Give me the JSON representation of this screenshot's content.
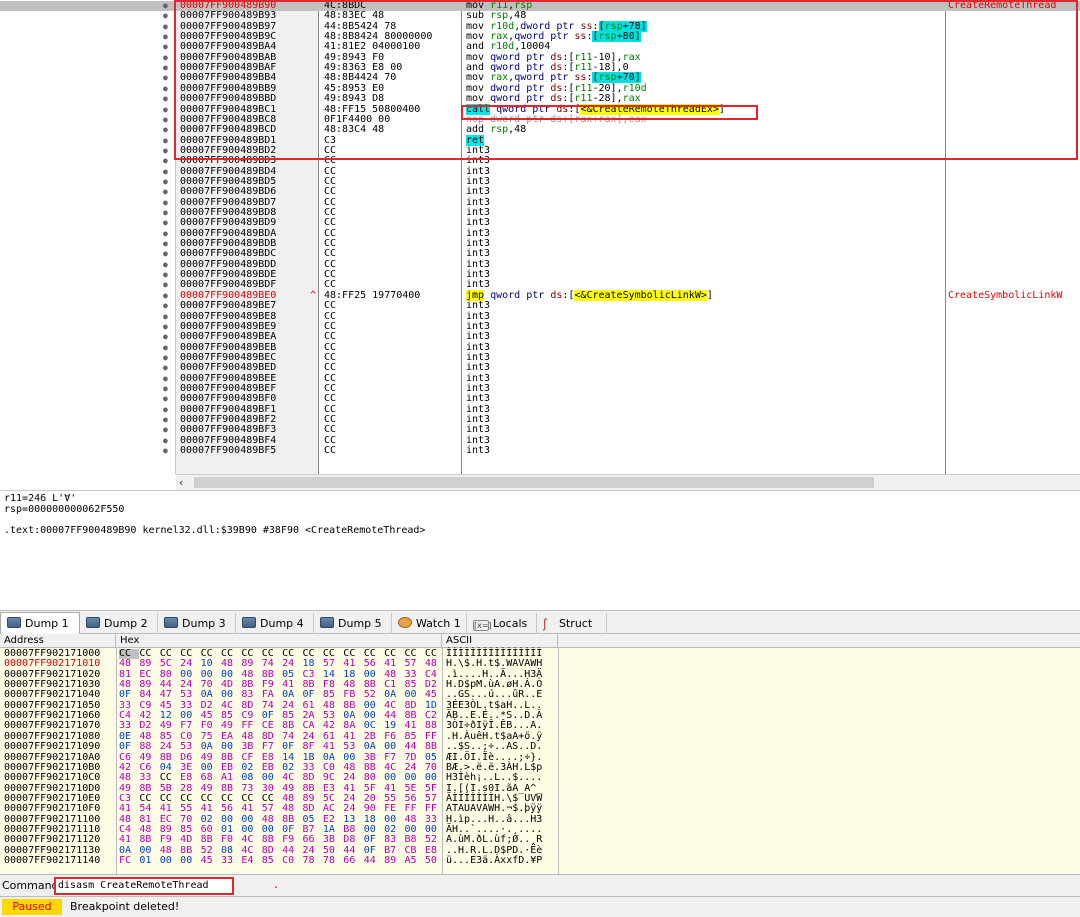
{
  "disasm": {
    "rows": [
      {
        "addr": "00007FF900489B90",
        "bytes": "4C:8BDC",
        "instr": "mov r11,rsp",
        "comment": "CreateRemoteThread",
        "current": true,
        "red": true
      },
      {
        "addr": "00007FF900489B93",
        "bytes": "48:83EC 48",
        "instr": "sub rsp,48"
      },
      {
        "addr": "00007FF900489B97",
        "bytes": "44:8B5424 78",
        "instr": "mov r10d,dword ptr ss:[rsp+78]"
      },
      {
        "addr": "00007FF900489B9C",
        "bytes": "48:8B8424 80000000",
        "instr": "mov rax,qword ptr ss:[rsp+80]"
      },
      {
        "addr": "00007FF900489BA4",
        "bytes": "41:81E2 04000100",
        "instr": "and r10d,10004"
      },
      {
        "addr": "00007FF900489BAB",
        "bytes": "49:8943 F0",
        "instr": "mov qword ptr ds:[r11-10],rax"
      },
      {
        "addr": "00007FF900489BAF",
        "bytes": "49:8363 E8 00",
        "instr": "and qword ptr ds:[r11-18],0"
      },
      {
        "addr": "00007FF900489BB4",
        "bytes": "48:8B4424 70",
        "instr": "mov rax,qword ptr ss:[rsp+70]"
      },
      {
        "addr": "00007FF900489BB9",
        "bytes": "45:8953 E0",
        "instr": "mov dword ptr ds:[r11-20],r10d"
      },
      {
        "addr": "00007FF900489BBD",
        "bytes": "49:8943 D8",
        "instr": "mov qword ptr ds:[r11-28],rax"
      },
      {
        "addr": "00007FF900489BC1",
        "bytes": "48:FF15 50800400",
        "instr": "call qword ptr ds:[<&CreateRemoteThreadEx>]"
      },
      {
        "addr": "00007FF900489BC8",
        "bytes": "0F1F4400 00",
        "instr": "nop dword ptr ds:[rax+rax],eax"
      },
      {
        "addr": "00007FF900489BCD",
        "bytes": "48:83C4 48",
        "instr": "add rsp,48"
      },
      {
        "addr": "00007FF900489BD1",
        "bytes": "C3",
        "instr": "ret"
      },
      {
        "addr": "00007FF900489BD2",
        "bytes": "CC",
        "instr": "int3"
      },
      {
        "addr": "00007FF900489BD3",
        "bytes": "CC",
        "instr": "int3"
      },
      {
        "addr": "00007FF900489BD4",
        "bytes": "CC",
        "instr": "int3"
      },
      {
        "addr": "00007FF900489BD5",
        "bytes": "CC",
        "instr": "int3"
      },
      {
        "addr": "00007FF900489BD6",
        "bytes": "CC",
        "instr": "int3"
      },
      {
        "addr": "00007FF900489BD7",
        "bytes": "CC",
        "instr": "int3"
      },
      {
        "addr": "00007FF900489BD8",
        "bytes": "CC",
        "instr": "int3"
      },
      {
        "addr": "00007FF900489BD9",
        "bytes": "CC",
        "instr": "int3"
      },
      {
        "addr": "00007FF900489BDA",
        "bytes": "CC",
        "instr": "int3"
      },
      {
        "addr": "00007FF900489BDB",
        "bytes": "CC",
        "instr": "int3"
      },
      {
        "addr": "00007FF900489BDC",
        "bytes": "CC",
        "instr": "int3"
      },
      {
        "addr": "00007FF900489BDD",
        "bytes": "CC",
        "instr": "int3"
      },
      {
        "addr": "00007FF900489BDE",
        "bytes": "CC",
        "instr": "int3"
      },
      {
        "addr": "00007FF900489BDF",
        "bytes": "CC",
        "instr": "int3"
      },
      {
        "addr": "00007FF900489BE0",
        "bytes": "48:FF25 19770400",
        "instr": "jmp qword ptr ds:[<&CreateSymbolicLinkW>]",
        "comment": "CreateSymbolicLinkW",
        "red": true,
        "jumpMark": "^"
      },
      {
        "addr": "00007FF900489BE7",
        "bytes": "CC",
        "instr": "int3"
      },
      {
        "addr": "00007FF900489BE8",
        "bytes": "CC",
        "instr": "int3"
      },
      {
        "addr": "00007FF900489BE9",
        "bytes": "CC",
        "instr": "int3"
      },
      {
        "addr": "00007FF900489BEA",
        "bytes": "CC",
        "instr": "int3"
      },
      {
        "addr": "00007FF900489BEB",
        "bytes": "CC",
        "instr": "int3"
      },
      {
        "addr": "00007FF900489BEC",
        "bytes": "CC",
        "instr": "int3"
      },
      {
        "addr": "00007FF900489BED",
        "bytes": "CC",
        "instr": "int3"
      },
      {
        "addr": "00007FF900489BEE",
        "bytes": "CC",
        "instr": "int3"
      },
      {
        "addr": "00007FF900489BEF",
        "bytes": "CC",
        "instr": "int3"
      },
      {
        "addr": "00007FF900489BF0",
        "bytes": "CC",
        "instr": "int3"
      },
      {
        "addr": "00007FF900489BF1",
        "bytes": "CC",
        "instr": "int3"
      },
      {
        "addr": "00007FF900489BF2",
        "bytes": "CC",
        "instr": "int3"
      },
      {
        "addr": "00007FF900489BF3",
        "bytes": "CC",
        "instr": "int3"
      },
      {
        "addr": "00007FF900489BF4",
        "bytes": "CC",
        "instr": "int3"
      },
      {
        "addr": "00007FF900489BF5",
        "bytes": "CC",
        "instr": "int3"
      }
    ]
  },
  "info": {
    "line1": "r11=246 L'Ɐ'",
    "line2": "rsp=000000000062F550",
    "line3": ".text:00007FF900489B90 kernel32.dll:$39B90 #38F90 <CreateRemoteThread>"
  },
  "tabs": [
    {
      "label": "Dump 1",
      "icon": "dump-icon",
      "active": true
    },
    {
      "label": "Dump 2",
      "icon": "dump-icon"
    },
    {
      "label": "Dump 3",
      "icon": "dump-icon"
    },
    {
      "label": "Dump 4",
      "icon": "dump-icon"
    },
    {
      "label": "Dump 5",
      "icon": "dump-icon"
    },
    {
      "label": "Watch 1",
      "icon": "watch-icon"
    },
    {
      "label": "Locals",
      "icon": "locals-icon",
      "iconText": "[x=]"
    },
    {
      "label": "Struct",
      "icon": "struct-icon",
      "iconText": "ʃ"
    }
  ],
  "dump": {
    "headers": {
      "address": "Address",
      "hex": "Hex",
      "ascii": "ASCII"
    },
    "rows": [
      {
        "addr": "00007FF902171000",
        "hex": "CC CC CC CC CC CC CC CC CC CC CC CC CC CC CC CC",
        "ascii": "ÌÌÌÌÌÌÌÌÌÌÌÌÌÌÌÌ",
        "selFirst": true
      },
      {
        "addr": "00007FF902171010",
        "hex": "48 89 5C 24 10 48 89 74 24 18 57 41 56 41 57 48",
        "ascii": "H.\\$.H.t$.WAVAWH",
        "red": true
      },
      {
        "addr": "00007FF902171020",
        "hex": "81 EC 80 00 00 00 48 8B 05 C3 14 18 00 48 33 C4",
        "ascii": ".ì....H..Ã...H3Ä"
      },
      {
        "addr": "00007FF902171030",
        "hex": "48 89 44 24 70 4D 8B F9 41 8B F8 48 8B C1 85 D2",
        "ascii": "H.D$pM.ùA.øH.Á.Ò"
      },
      {
        "addr": "00007FF902171040",
        "hex": "0F 84 47 53 0A 00 83 FA 0A 0F 85 FB 52 0A 00 45",
        "ascii": "..GS...ú...ûR..E"
      },
      {
        "addr": "00007FF902171050",
        "hex": "33 C9 45 33 D2 4C 8D 74 24 61 48 8B 00 4C 8D 1D",
        "ascii": "3ÉE3ÒL.t$aH..L.."
      },
      {
        "addr": "00007FF902171060",
        "hex": "C4 42 12 00 45 85 C9 0F 85 2A 53 0A 00 44 8B C2",
        "ascii": "ÄB..E.É..*S..D.Â"
      },
      {
        "addr": "00007FF902171070",
        "hex": "33 D2 49 F7 F0 49 FF CE 8B CA 42 8A 0C 19 41 88",
        "ascii": "3ÒI÷ðIÿÎ.ÊB...A."
      },
      {
        "addr": "00007FF902171080",
        "hex": "0E 48 85 C0 75 EA 48 8D 74 24 61 41 2B F6 85 FF",
        "ascii": ".H.ÀuêH.t$aA+ö.ÿ"
      },
      {
        "addr": "00007FF902171090",
        "hex": "0F 88 24 53 0A 00 3B F7 0F 8F 41 53 0A 00 44 8B",
        "ascii": "..$S..;÷..AS..D."
      },
      {
        "addr": "00007FF9021710A0",
        "hex": "C6 49 8B D6 49 8B CF E8 14 1B 0A 00 3B F7 7D 05",
        "ascii": "ÆI.ÖI.Ïè....;÷}."
      },
      {
        "addr": "00007FF9021710B0",
        "hex": "42 C6 04 3E 00 EB 02 EB 02 33 C0 48 8B 4C 24 70",
        "ascii": "BÆ.>.ë.ë.3ÀH.L$p"
      },
      {
        "addr": "00007FF9021710C0",
        "hex": "48 33 CC E8 68 A1 08 00 4C 8D 9C 24 80 00 00 00",
        "ascii": "H3Ìèh¡..L..$...."
      },
      {
        "addr": "00007FF9021710D0",
        "hex": "49 8B 5B 28 49 8B 73 30 49 8B E3 41 5F 41 5E 5F",
        "ascii": "I.[(I.s0I.ãA_A^_"
      },
      {
        "addr": "00007FF9021710E0",
        "hex": "C3 CC CC CC CC CC CC CC 48 89 5C 24 20 55 56 57",
        "ascii": "ÃÌÌÌÌÌÌÌH.\\$ UVW"
      },
      {
        "addr": "00007FF9021710F0",
        "hex": "41 54 41 55 41 56 41 57 48 8D AC 24 90 FE FF FF",
        "ascii": "ATAUAVAWH.¬$.þÿÿ"
      },
      {
        "addr": "00007FF902171100",
        "hex": "48 81 EC 70 02 00 00 48 8B 05 E2 13 18 00 48 33",
        "ascii": "H.ìp...H..â...H3"
      },
      {
        "addr": "00007FF902171110",
        "hex": "C4 48 89 85 60 01 00 00 0F B7 1A B8 00 02 00 00",
        "ascii": "ÄH..`....·.¸...."
      },
      {
        "addr": "00007FF902171120",
        "hex": "41 8B F9 4D 8B F0 4C 8B F9 66 3B D8 0F 83 B8 52",
        "ascii": "A.ùM.ðL.ùf;Ø..¸R"
      },
      {
        "addr": "00007FF902171130",
        "hex": "0A 00 48 8B 52 08 4C 8D 44 24 50 44 0F B7 CB E8",
        "ascii": "..H.R.L.D$PD.·Ëè"
      },
      {
        "addr": "00007FF902171140",
        "hex": "FC 01 00 00 45 33 E4 85 C0 78 78 66 44 89 A5 50",
        "ascii": "ü...E3ä.ÀxxfD.¥P"
      }
    ]
  },
  "command": {
    "label": "Command:",
    "value": "disasm CreateRemoteThread",
    "dot": "."
  },
  "status": {
    "state": "Paused",
    "message": "Breakpoint deleted!"
  }
}
